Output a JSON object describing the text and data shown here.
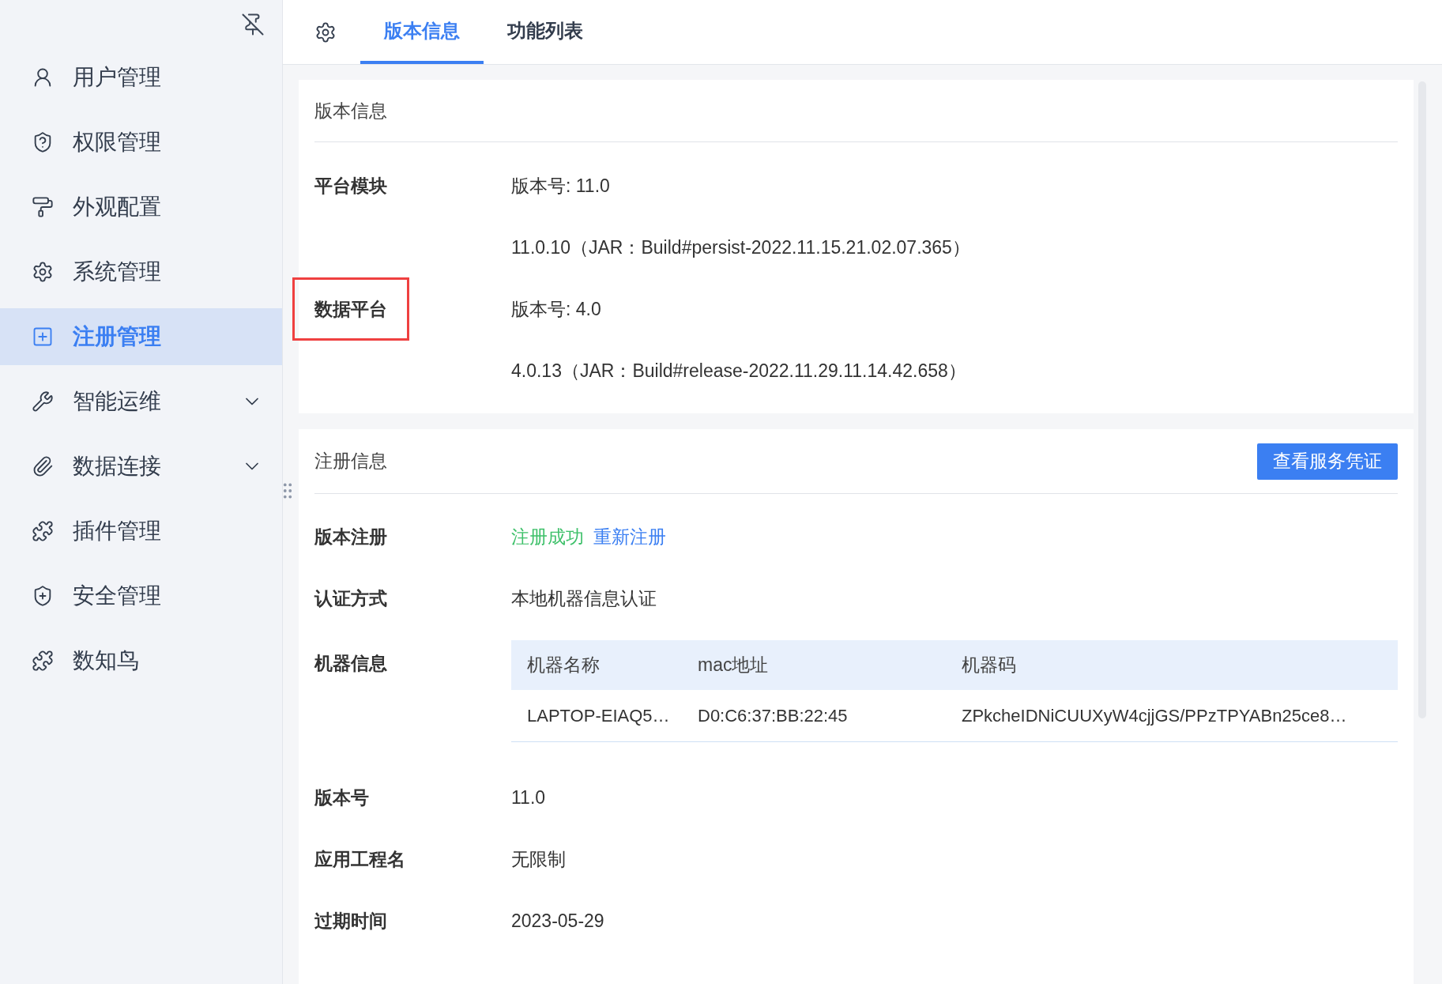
{
  "sidebar": {
    "items": [
      {
        "label": "用户管理",
        "selected": false,
        "expandable": false
      },
      {
        "label": "权限管理",
        "selected": false,
        "expandable": false
      },
      {
        "label": "外观配置",
        "selected": false,
        "expandable": false
      },
      {
        "label": "系统管理",
        "selected": false,
        "expandable": false
      },
      {
        "label": "注册管理",
        "selected": true,
        "expandable": false
      },
      {
        "label": "智能运维",
        "selected": false,
        "expandable": true
      },
      {
        "label": "数据连接",
        "selected": false,
        "expandable": true
      },
      {
        "label": "插件管理",
        "selected": false,
        "expandable": false
      },
      {
        "label": "安全管理",
        "selected": false,
        "expandable": false
      },
      {
        "label": "数知鸟",
        "selected": false,
        "expandable": false
      }
    ]
  },
  "tabs": [
    {
      "label": "版本信息",
      "selected": true
    },
    {
      "label": "功能列表",
      "selected": false
    }
  ],
  "version_card": {
    "title": "版本信息",
    "rows": [
      {
        "label": "平台模块",
        "highlighted": false,
        "lines": [
          "版本号: 11.0",
          "11.0.10（JAR：Build#persist-2022.11.15.21.02.07.365）"
        ]
      },
      {
        "label": "数据平台",
        "highlighted": true,
        "lines": [
          "版本号: 4.0",
          "4.0.13（JAR：Build#release-2022.11.29.11.14.42.658）"
        ]
      }
    ]
  },
  "registration_card": {
    "title": "注册信息",
    "button": "查看服务凭证",
    "rows": [
      {
        "kind": "status",
        "label": "版本注册",
        "status": "注册成功",
        "link": "重新注册"
      },
      {
        "kind": "text",
        "label": "认证方式",
        "value": "本地机器信息认证"
      },
      {
        "kind": "table",
        "label": "机器信息",
        "table": {
          "columns": [
            "机器名称",
            "mac地址",
            "机器码"
          ],
          "rows": [
            [
              "LAPTOP-EIAQ5…",
              "D0:C6:37:BB:22:45",
              "ZPkcheIDNiCUUXyW4cjjGS/PPzTPYABn25ce8…"
            ]
          ]
        }
      },
      {
        "kind": "text",
        "label": "版本号",
        "value": "11.0"
      },
      {
        "kind": "text",
        "label": "应用工程名",
        "value": "无限制"
      },
      {
        "kind": "text",
        "label": "过期时间",
        "value": "2023-05-29"
      }
    ]
  }
}
